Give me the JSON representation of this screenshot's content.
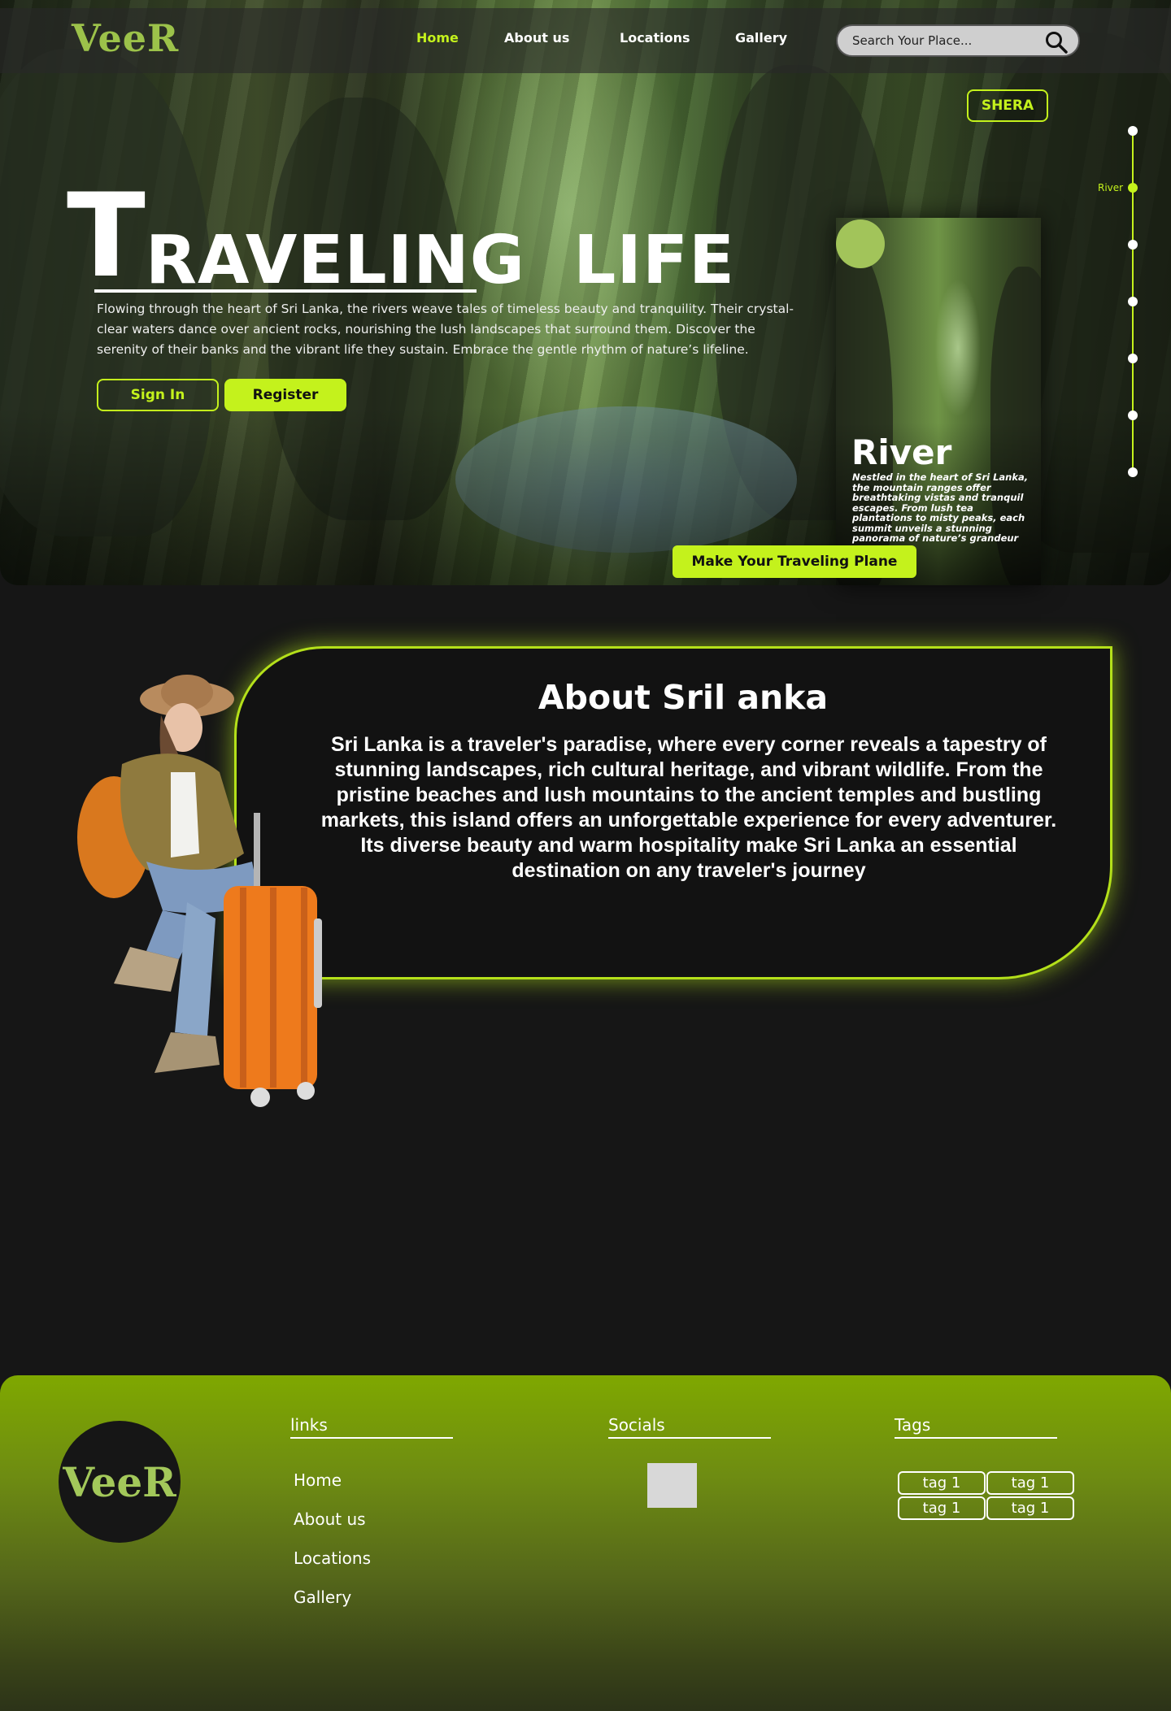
{
  "brand": {
    "logo_text": "VeeR",
    "accent": "#c4f21c",
    "logo_color": "#9cc24a"
  },
  "nav": {
    "items": [
      {
        "label": "Home",
        "active": true
      },
      {
        "label": "About us",
        "active": false
      },
      {
        "label": "Locations",
        "active": false
      },
      {
        "label": "Gallery",
        "active": false
      }
    ],
    "search_placeholder": "Search Your Place...",
    "search_icon": "search-icon"
  },
  "hero": {
    "badge": "SHERA",
    "title_first_letter": "T",
    "title_rest": "RAVELING  LIFE",
    "description": "Flowing through the heart of Sri Lanka, the rivers weave tales of timeless beauty and tranquility. Their crystal-clear waters dance over ancient rocks, nourishing the lush landscapes that surround them. Discover the serenity of their banks and the vibrant life they sustain. Embrace the gentle rhythm of nature’s lifeline.",
    "signin_label": "Sign In",
    "register_label": "Register",
    "plan_label": "Make Your Traveling Plane",
    "timeline_active_label": "River"
  },
  "card": {
    "title": "River",
    "text": "Nestled in the heart of Sri Lanka, the mountain ranges offer breathtaking vistas and tranquil escapes. From lush tea plantations to misty peaks, each summit unveils a stunning panorama of nature’s grandeur"
  },
  "about": {
    "title": "About Sril anka",
    "text": "Sri Lanka is a traveler's paradise, where every corner reveals a tapestry of stunning landscapes, rich cultural heritage, and vibrant wildlife. From the pristine beaches and lush mountains to the ancient temples and bustling markets, this island offers an unforgettable experience for every adventurer. Its diverse beauty and warm hospitality make Sri Lanka an essential destination on any traveler's journey"
  },
  "footer": {
    "logo_text": "VeeR",
    "links_heading": "links",
    "links": [
      "Home",
      "About us",
      "Locations",
      "Gallery"
    ],
    "socials_heading": "Socials",
    "tags_heading": "Tags",
    "tags": [
      "tag 1",
      "tag 1",
      "tag 1",
      "tag 1"
    ]
  }
}
